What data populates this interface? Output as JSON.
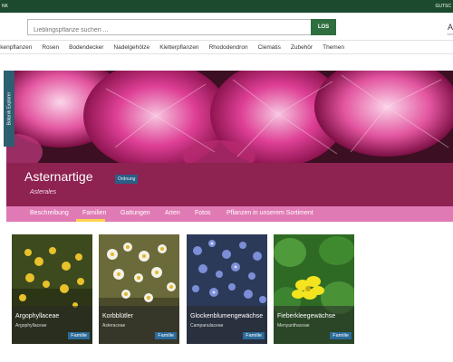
{
  "topbar": {
    "left_text": "NK",
    "right_text": "GUTSC"
  },
  "search": {
    "placeholder": "Lieblingspflanze suchen ...",
    "button_label": "LOS"
  },
  "account": {
    "initial": "A",
    "sub": "Mei"
  },
  "nav": {
    "items": [
      "ckenpflanzen",
      "Rosen",
      "Bodendecker",
      "Nadelgehölze",
      "Kletterpflanzen",
      "Rhododendron",
      "Clematis",
      "Zubehör",
      "Themen"
    ]
  },
  "explorer": {
    "label": "Botanik Explorer"
  },
  "header": {
    "title": "Asternartige",
    "badge": "Ordnung",
    "latin": "Asterales"
  },
  "tabs": [
    {
      "label": "Beschreibung",
      "active": false
    },
    {
      "label": "Familien",
      "active": true
    },
    {
      "label": "Gattungen",
      "active": false
    },
    {
      "label": "Arten",
      "active": false
    },
    {
      "label": "Fotos",
      "active": false
    },
    {
      "label": "Pflanzen in unserem Sortiment",
      "active": false
    }
  ],
  "cards": [
    {
      "name": "Argophyllaceae",
      "sub": "Argophyllaceae",
      "badge": "Familie"
    },
    {
      "name": "Korbblütler",
      "sub": "Asteraceae",
      "badge": "Familie"
    },
    {
      "name": "Glockenblumengewächse",
      "sub": "Campanulaceae",
      "badge": "Familie"
    },
    {
      "name": "Fieberkleegewächse",
      "sub": "Menyanthaceae",
      "badge": "Familie"
    }
  ],
  "colors": {
    "topbar": "#1b4a2e",
    "button": "#2f6e3f",
    "titlebar": "#8e2251",
    "tabs": "#e07ab4",
    "tab_indicator": "#ffd24c",
    "badge": "#2a6a9a"
  }
}
